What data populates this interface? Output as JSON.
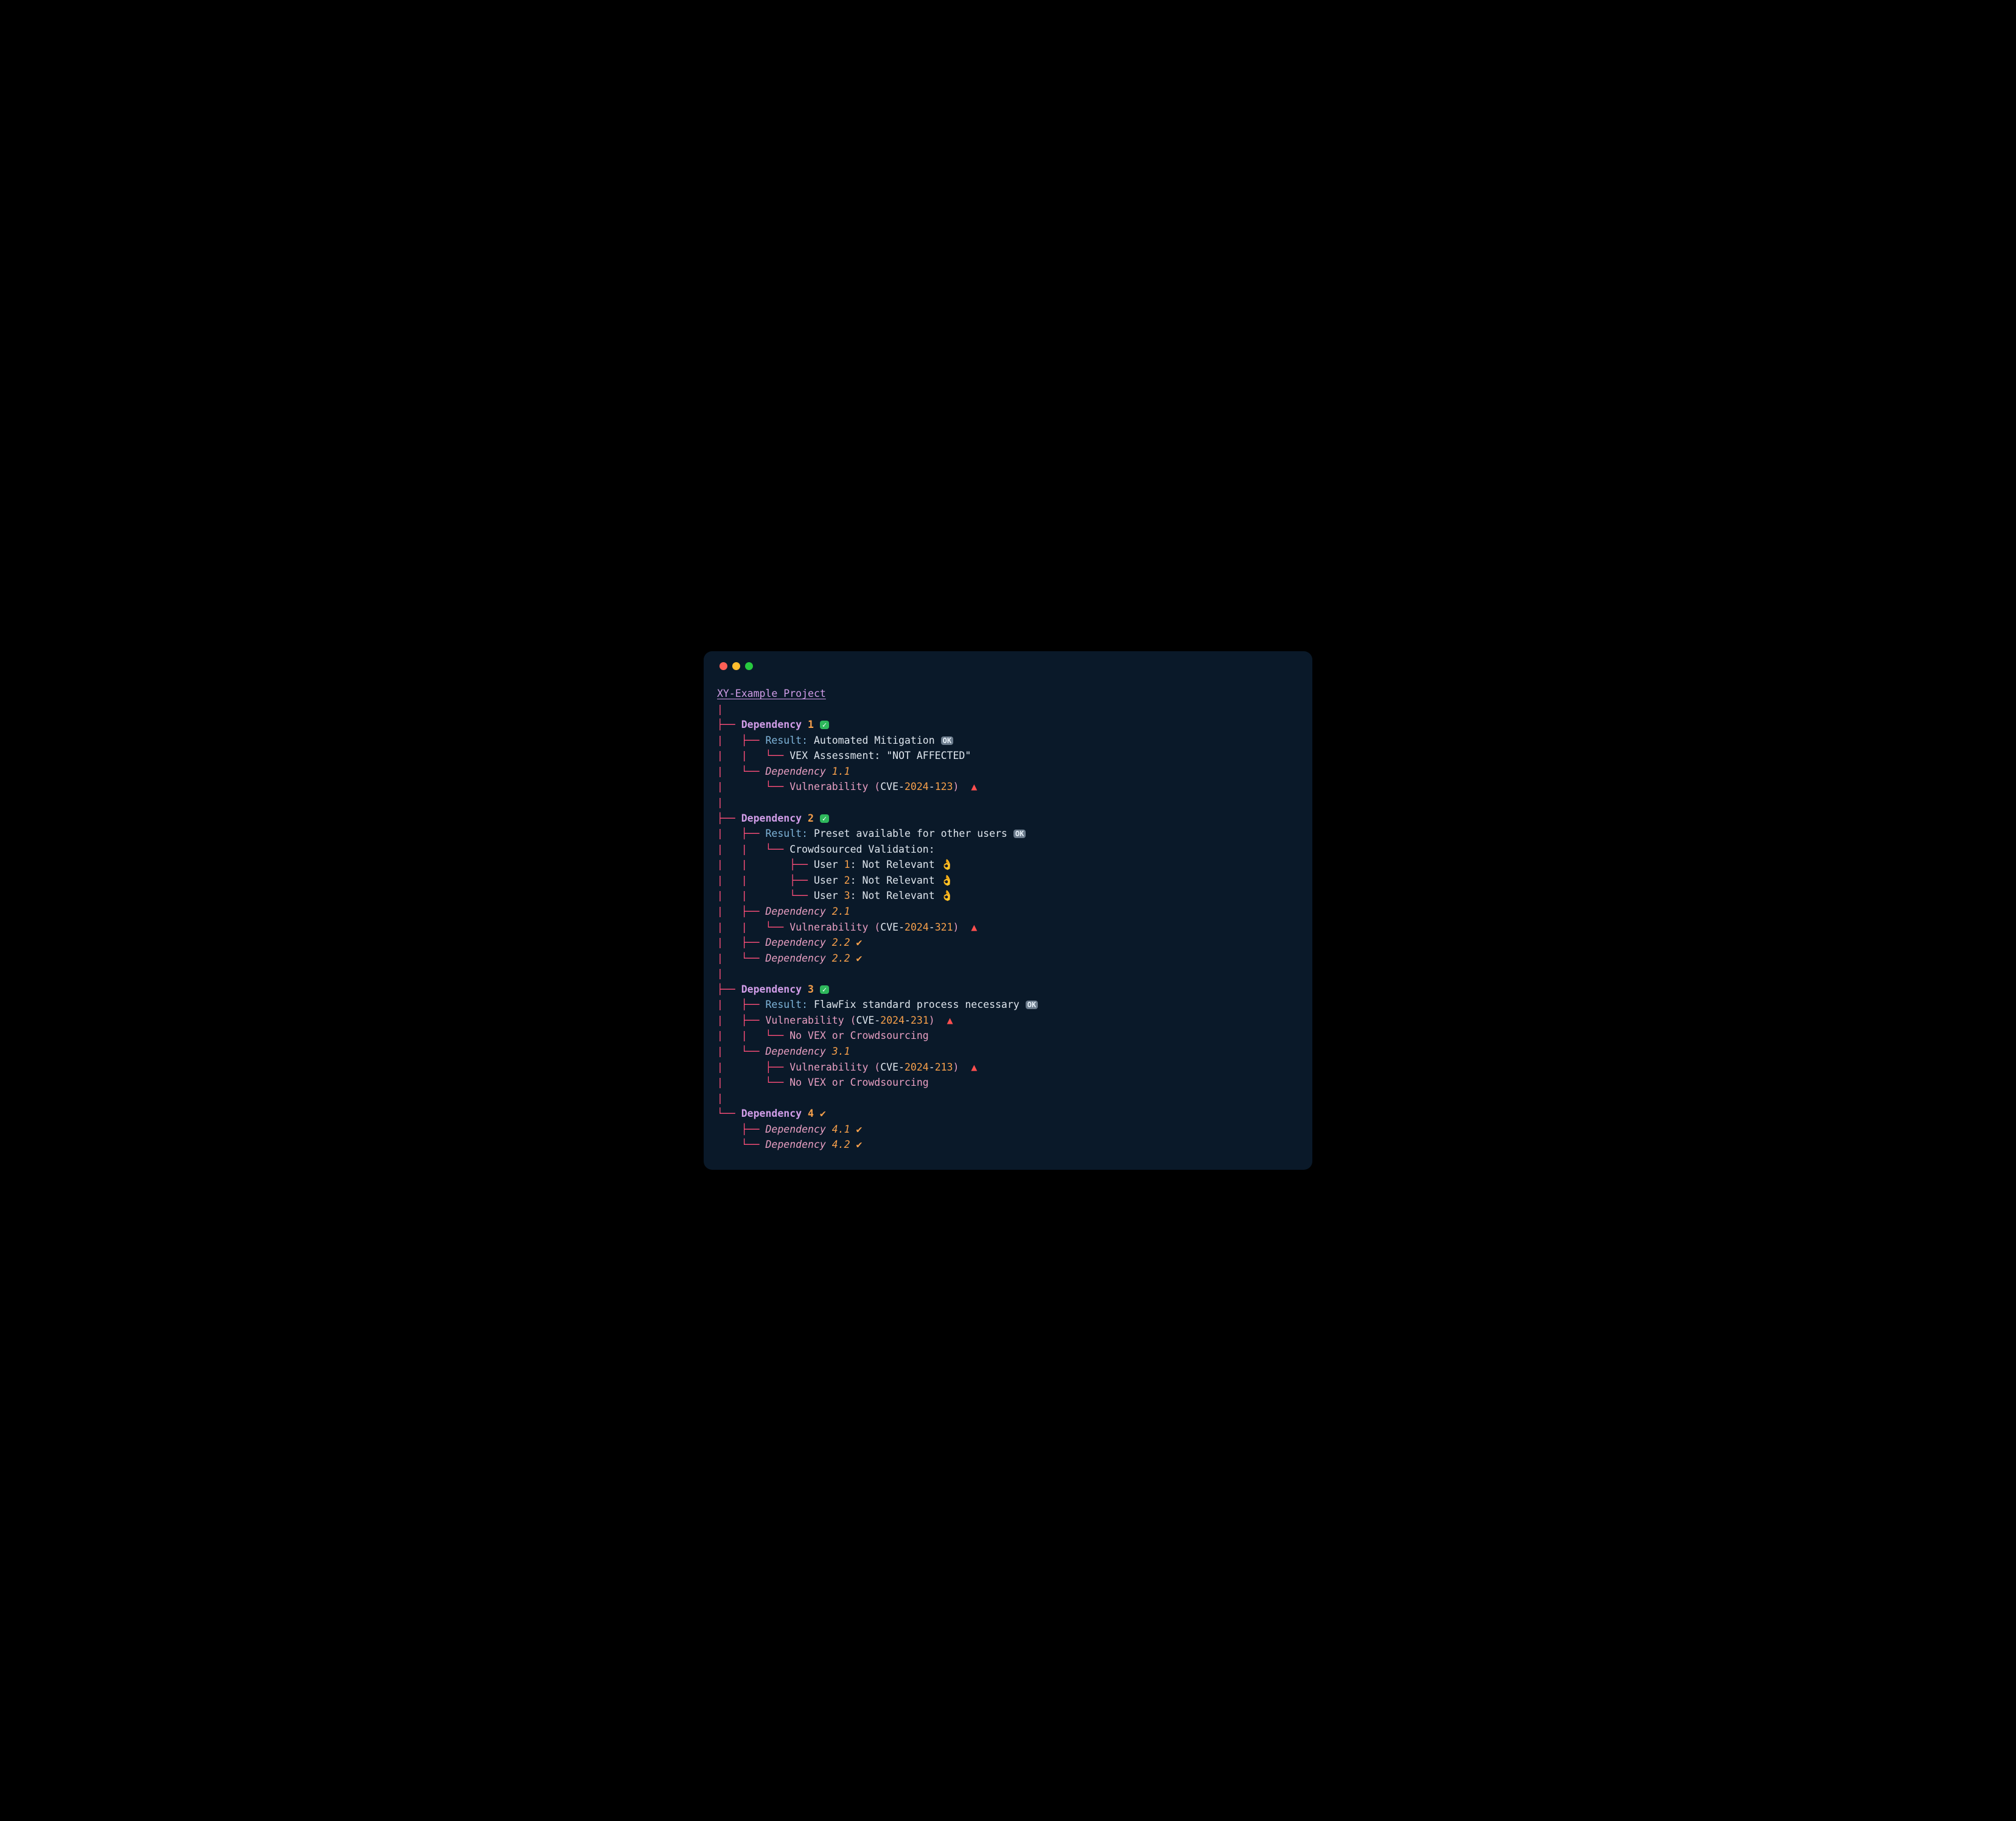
{
  "window": {
    "title": "XY-Example Project"
  },
  "icons": {
    "ok_badge": "OK",
    "checkmark": "✓",
    "warning_triangle": "▲",
    "tick": "✔",
    "okhand": "👌"
  },
  "tree": {
    "dep1": {
      "name_prefix": "Dependency ",
      "num": "1",
      "result_label": "Result: ",
      "result_value": "Automated Mitigation ",
      "vex_label": "VEX Assessment: ",
      "vex_value": "\"NOT AFFECTED\"",
      "sub1_name": "Dependency ",
      "sub1_num": "1.1",
      "vuln_label": "Vulnerability (",
      "cve_prefix": "CVE-",
      "cve_year": "2024",
      "cve_dash": "-",
      "cve_num": "123",
      "vuln_close": ") "
    },
    "dep2": {
      "name_prefix": "Dependency ",
      "num": "2",
      "result_label": "Result: ",
      "result_value": "Preset available for other users ",
      "crowd_label": "Crowdsourced Validation:",
      "user_label": "User ",
      "user1_num": "1",
      "user2_num": "2",
      "user3_num": "3",
      "user_sep": ": ",
      "user_verdict": "Not Relevant ",
      "sub1_name": "Dependency ",
      "sub1_num": "2.1",
      "vuln_label": "Vulnerability (",
      "cve_prefix": "CVE-",
      "cve_year": "2024",
      "cve_dash": "-",
      "cve_num": "321",
      "vuln_close": ") ",
      "sub2_name": "Dependency ",
      "sub2_num": "2.2",
      "sub3_name": "Dependency ",
      "sub3_num": "2.2"
    },
    "dep3": {
      "name_prefix": "Dependency ",
      "num": "3",
      "result_label": "Result: ",
      "result_value": "FlawFix standard process necessary ",
      "vuln_label": "Vulnerability (",
      "cve_prefix": "CVE-",
      "cve_year": "2024",
      "cve_dash": "-",
      "cve_num1": "231",
      "vuln_close": ") ",
      "no_vex": "No VEX or Crowdsourcing",
      "sub1_name": "Dependency ",
      "sub1_num": "3.1",
      "cve_num2": "213"
    },
    "dep4": {
      "name_prefix": "Dependency ",
      "num": "4",
      "sub1_name": "Dependency ",
      "sub1_num": "4.1",
      "sub2_name": "Dependency ",
      "sub2_num": "4.2"
    }
  }
}
